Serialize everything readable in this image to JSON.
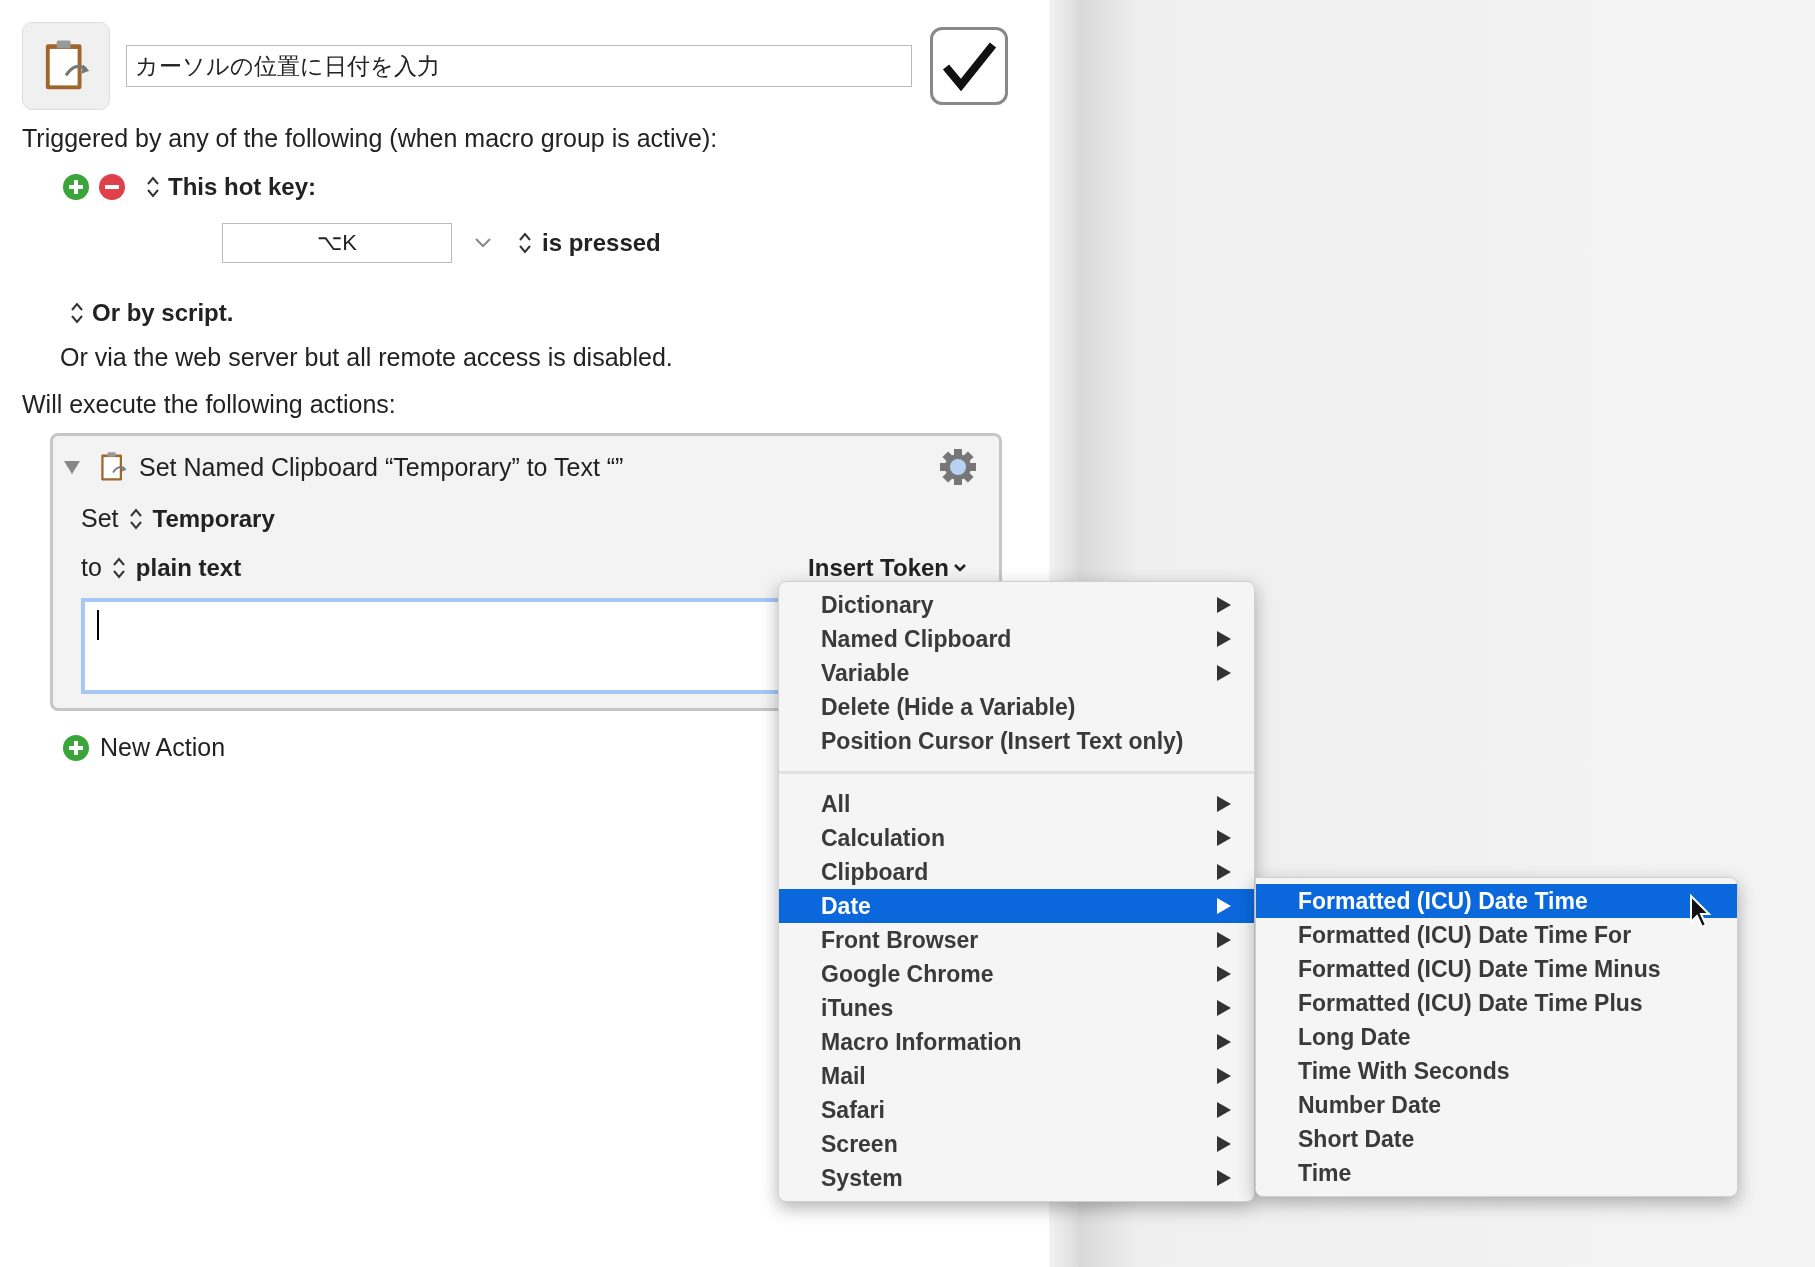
{
  "macro": {
    "title": "カーソルの位置に日付を入力",
    "enabled": true
  },
  "trigger_intro": "Triggered by any of the following (when macro group is active):",
  "hotkey_trigger": {
    "label": "This hot key:",
    "key": "⌥K",
    "condition": "is pressed"
  },
  "script_trigger": "Or by script.",
  "web_server_note": "Or via the web server but all remote access is disabled.",
  "actions_intro": "Will execute the following actions:",
  "action": {
    "title": "Set Named Clipboard “Temporary” to Text “”",
    "expanded": true,
    "set_label": "Set",
    "clipboard": "Temporary",
    "to_label": "to",
    "text_kind": "plain text",
    "insert_token": "Insert Token"
  },
  "new_action": "New Action",
  "token_menu": {
    "groups": [
      [
        {
          "label": "Dictionary",
          "submenu": true,
          "selected": false
        },
        {
          "label": "Named Clipboard",
          "submenu": true,
          "selected": false
        },
        {
          "label": "Variable",
          "submenu": true,
          "selected": false
        },
        {
          "label": "Delete (Hide a Variable)",
          "submenu": false,
          "selected": false
        },
        {
          "label": "Position Cursor (Insert Text only)",
          "submenu": false,
          "selected": false
        }
      ],
      [
        {
          "label": "All",
          "submenu": true,
          "selected": false
        },
        {
          "label": "Calculation",
          "submenu": true,
          "selected": false
        },
        {
          "label": "Clipboard",
          "submenu": true,
          "selected": false
        },
        {
          "label": "Date",
          "submenu": true,
          "selected": true
        },
        {
          "label": "Front Browser",
          "submenu": true,
          "selected": false
        },
        {
          "label": "Google Chrome",
          "submenu": true,
          "selected": false
        },
        {
          "label": "iTunes",
          "submenu": true,
          "selected": false
        },
        {
          "label": "Macro Information",
          "submenu": true,
          "selected": false
        },
        {
          "label": "Mail",
          "submenu": true,
          "selected": false
        },
        {
          "label": "Safari",
          "submenu": true,
          "selected": false
        },
        {
          "label": "Screen",
          "submenu": true,
          "selected": false
        },
        {
          "label": "System",
          "submenu": true,
          "selected": false
        }
      ]
    ]
  },
  "date_submenu": {
    "items": [
      {
        "label": "Formatted (ICU) Date Time",
        "selected": true
      },
      {
        "label": "Formatted (ICU) Date Time For",
        "selected": false
      },
      {
        "label": "Formatted (ICU) Date Time Minus",
        "selected": false
      },
      {
        "label": "Formatted (ICU) Date Time Plus",
        "selected": false
      },
      {
        "label": "Long Date",
        "selected": false
      },
      {
        "label": "Time With Seconds",
        "selected": false
      },
      {
        "label": "Number Date",
        "selected": false
      },
      {
        "label": "Short Date",
        "selected": false
      },
      {
        "label": "Time",
        "selected": false
      }
    ]
  }
}
